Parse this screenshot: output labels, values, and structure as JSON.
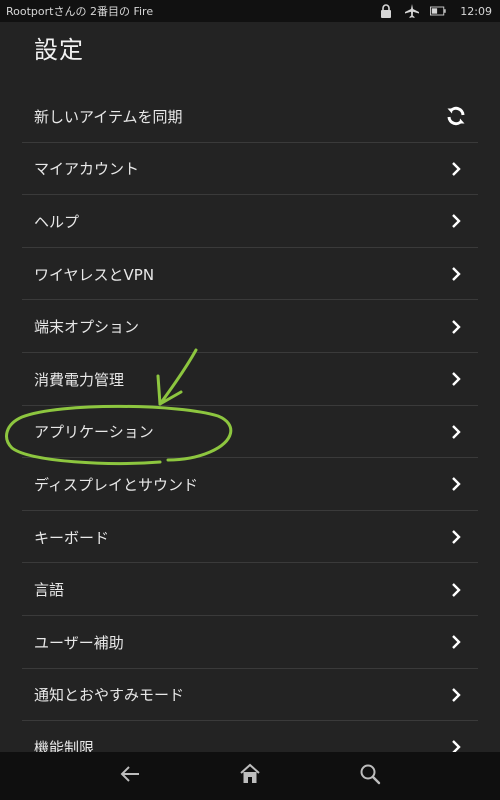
{
  "status_bar": {
    "device_name": "Rootportさんの 2番目の Fire",
    "time": "12:09"
  },
  "header": {
    "title": "設定"
  },
  "settings": {
    "items": [
      {
        "label": "新しいアイテムを同期",
        "icon": "sync-icon"
      },
      {
        "label": "マイアカウント",
        "icon": "chevron-right-icon"
      },
      {
        "label": "ヘルプ",
        "icon": "chevron-right-icon"
      },
      {
        "label": "ワイヤレスとVPN",
        "icon": "chevron-right-icon"
      },
      {
        "label": "端末オプション",
        "icon": "chevron-right-icon"
      },
      {
        "label": "消費電力管理",
        "icon": "chevron-right-icon"
      },
      {
        "label": "アプリケーション",
        "icon": "chevron-right-icon"
      },
      {
        "label": "ディスプレイとサウンド",
        "icon": "chevron-right-icon"
      },
      {
        "label": "キーボード",
        "icon": "chevron-right-icon"
      },
      {
        "label": "言語",
        "icon": "chevron-right-icon"
      },
      {
        "label": "ユーザー補助",
        "icon": "chevron-right-icon"
      },
      {
        "label": "通知とおやすみモード",
        "icon": "chevron-right-icon"
      },
      {
        "label": "機能制限",
        "icon": "chevron-right-icon"
      }
    ]
  },
  "navigation": {
    "icons": [
      "back-arrow-icon",
      "home-icon",
      "search-icon"
    ]
  },
  "annotation": {
    "color": "#8dc63f",
    "highlighted_item": "アプリケーション"
  },
  "colors": {
    "background": "#232323",
    "divider": "#3a3a3a",
    "text": "#e8e8e8",
    "status_bar": "#111111",
    "nav_bar": "#0f0f0f"
  }
}
